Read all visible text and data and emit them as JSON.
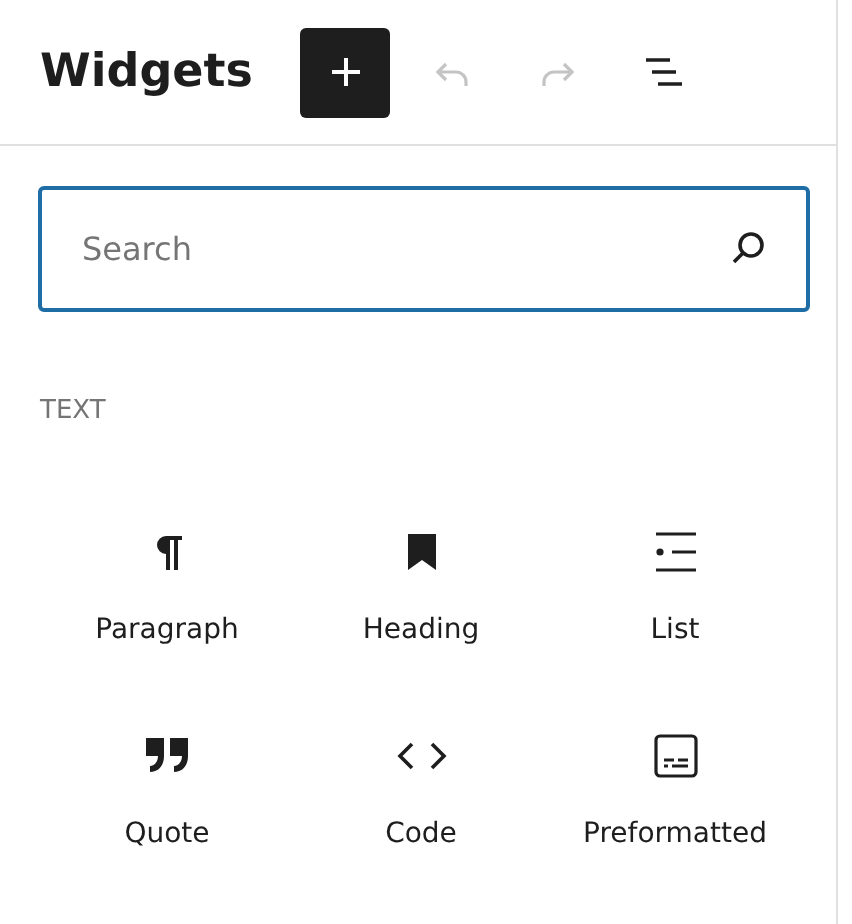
{
  "header": {
    "title": "Widgets",
    "toolbar": [
      {
        "kind": "add",
        "disabled": false
      },
      {
        "kind": "undo",
        "disabled": true
      },
      {
        "kind": "redo",
        "disabled": true
      },
      {
        "kind": "outline",
        "disabled": false
      }
    ]
  },
  "search": {
    "placeholder": "Search"
  },
  "category": "TEXT",
  "blocks": [
    {
      "kind": "paragraph",
      "label": "Paragraph"
    },
    {
      "kind": "heading",
      "label": "Heading"
    },
    {
      "kind": "list",
      "label": "List"
    },
    {
      "kind": "quote",
      "label": "Quote"
    },
    {
      "kind": "code",
      "label": "Code"
    },
    {
      "kind": "preformatted",
      "label": "Preformatted"
    }
  ]
}
